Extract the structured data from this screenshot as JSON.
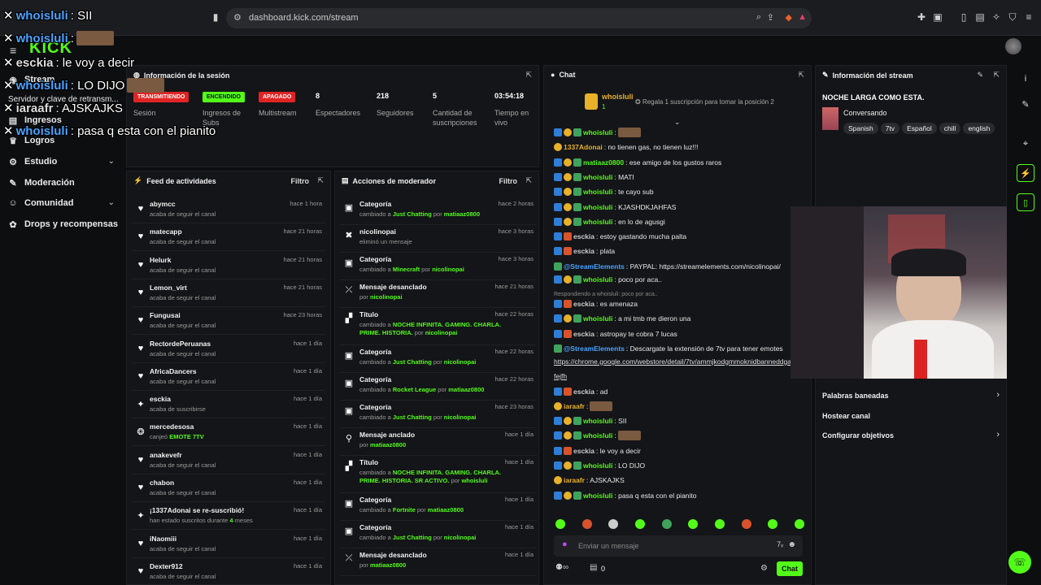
{
  "browser": {
    "url": "dashboard.kick.com/stream"
  },
  "app": {
    "logo": "KICK"
  },
  "sidebar": {
    "items": [
      {
        "label": "Stream",
        "icon": "stream-icon"
      },
      {
        "label": "Servidor y clave de retransm...",
        "icon": "key-icon"
      },
      {
        "label": "Ingresos",
        "icon": "money-icon"
      },
      {
        "label": "Logros",
        "icon": "trophy-icon"
      },
      {
        "label": "Estudio",
        "icon": "studio-icon",
        "expandable": true
      },
      {
        "label": "Moderación",
        "icon": "wrench-icon"
      },
      {
        "label": "Comunidad",
        "icon": "community-icon",
        "expandable": true
      },
      {
        "label": "Drops y recompensas",
        "icon": "gift-icon"
      }
    ]
  },
  "session": {
    "title": "Información de la sesión",
    "stats": [
      {
        "badge": "TRANSMITIENDO",
        "label": "Sesión",
        "color": "#e02424"
      },
      {
        "badge": "ENCENDIDO",
        "label": "Ingresos de Subs",
        "color": "#53fc18"
      },
      {
        "badge": "APAGADO",
        "label": "Multistream",
        "color": "#e02424"
      },
      {
        "value": "8",
        "label": "Espectadores"
      },
      {
        "value": "218",
        "label": "Seguidores"
      },
      {
        "value": "5",
        "label": "Cantidad de suscripciones"
      },
      {
        "value": "03:54:18",
        "label": "Tiempo en vivo"
      }
    ]
  },
  "feed": {
    "title": "Feed de actividades",
    "filter": "Filtro",
    "items": [
      {
        "name": "abymcc",
        "desc": "acaba de seguir el canal",
        "time": "hace 1 hora",
        "icon": "heart-icon"
      },
      {
        "name": "matecapp",
        "desc": "acaba de seguir el canal",
        "time": "hace 21 horas",
        "icon": "heart-icon"
      },
      {
        "name": "Helurk",
        "desc": "acaba de seguir el canal",
        "time": "hace 21 horas",
        "icon": "heart-icon"
      },
      {
        "name": "Lemon_virt",
        "desc": "acaba de seguir el canal",
        "time": "hace 21 horas",
        "icon": "heart-icon"
      },
      {
        "name": "Fungusai",
        "desc": "acaba de seguir el canal",
        "time": "hace 23 horas",
        "icon": "heart-icon"
      },
      {
        "name": "RectordePeruanas",
        "desc": "acaba de seguir el canal",
        "time": "hace 1 día",
        "icon": "heart-icon"
      },
      {
        "name": "AfricaDancers",
        "desc": "acaba de seguir el canal",
        "time": "hace 1 día",
        "icon": "heart-icon"
      },
      {
        "name": "esckia",
        "desc": "acaba de suscribirse",
        "time": "hace 1 día",
        "icon": "star-icon"
      },
      {
        "name": "mercedesosa",
        "desc_pre": "canjeó ",
        "desc_hl": "EMOTE 7TV",
        "time": "hace 1 día",
        "icon": "redeem-icon"
      },
      {
        "name": "anakevefr",
        "desc": "acaba de seguir el canal",
        "time": "hace 1 día",
        "icon": "heart-icon"
      },
      {
        "name": "chabon",
        "desc": "acaba de seguir el canal",
        "time": "hace 1 día",
        "icon": "heart-icon"
      },
      {
        "name": "¡1337Adonai se re-suscribió!",
        "desc_pre": "han estado suscritos durante ",
        "desc_hl": "4",
        "desc_post": " meses",
        "time": "hace 1 día",
        "icon": "star-icon"
      },
      {
        "name": "iNaomiii",
        "desc": "acaba de seguir el canal",
        "time": "hace 1 día",
        "icon": "heart-icon"
      },
      {
        "name": "Dexter912",
        "desc": "acaba de seguir el canal",
        "time": "hace 1 día",
        "icon": "heart-icon"
      }
    ]
  },
  "mod": {
    "title": "Acciones de moderador",
    "filter": "Filtro",
    "items": [
      {
        "name": "Categoría",
        "a": "cambiado a ",
        "b": "Just Chatting",
        "c": " por ",
        "d": "matiaaz0800",
        "time": "hace 2 horas",
        "icon": "category-icon"
      },
      {
        "name": "nicolinopai",
        "a": "eliminó un mensaje",
        "time": "hace 3 horas",
        "icon": "trash-icon"
      },
      {
        "name": "Categoría",
        "a": "cambiado a ",
        "b": "Minecraft",
        "c": " por ",
        "d": "nicolinopai",
        "time": "hace 3 horas",
        "icon": "category-icon"
      },
      {
        "name": "Mensaje desanclado",
        "a": "por ",
        "d": "nicolinopai",
        "time": "hace 21 horas",
        "icon": "unpin-icon"
      },
      {
        "name": "Título",
        "a": "cambiado a ",
        "b": "NOCHE INFINITA. GAMING. CHARLA. PRIME. HISTORIA.",
        "c": " por ",
        "d": "nicolinopai",
        "time": "hace 22 horas",
        "icon": "title-icon"
      },
      {
        "name": "Categoría",
        "a": "cambiado a ",
        "b": "Just Chatting",
        "c": " por ",
        "d": "nicolinopai",
        "time": "hace 22 horas",
        "icon": "category-icon"
      },
      {
        "name": "Categoría",
        "a": "cambiado a ",
        "b": "Rocket League",
        "c": " por ",
        "d": "matiaaz0800",
        "time": "hace 22 horas",
        "icon": "category-icon"
      },
      {
        "name": "Categoría",
        "a": "cambiado a ",
        "b": "Just Chatting",
        "c": " por ",
        "d": "nicolinopai",
        "time": "hace 23 horas",
        "icon": "category-icon"
      },
      {
        "name": "Mensaje anclado",
        "a": "por ",
        "d": "matiaaz0800",
        "time": "hace 1 día",
        "icon": "pin-icon"
      },
      {
        "name": "Título",
        "a": "cambiado a ",
        "b": "NOCHE INFINITA. GAMING. CHARLA. PRIME. HISTORIA. SR ACTIVO.",
        "c": " por ",
        "d": "whoisluli",
        "time": "hace 1 día",
        "icon": "title-icon"
      },
      {
        "name": "Categoría",
        "a": "cambiado a ",
        "b": "Fortnite",
        "c": " por ",
        "d": "matiaaz0800",
        "time": "hace 1 día",
        "icon": "category-icon"
      },
      {
        "name": "Categoría",
        "a": "cambiado a ",
        "b": "Just Chatting",
        "c": " por ",
        "d": "nicolinopai",
        "time": "hace 1 día",
        "icon": "category-icon"
      },
      {
        "name": "Mensaje desanclado",
        "a": "por ",
        "d": "matiaaz0800",
        "time": "hace 1 día",
        "icon": "unpin-icon"
      }
    ]
  },
  "chat": {
    "title": "Chat",
    "top_user": "whoisluli",
    "top_count": "1",
    "gift_text": "Regala 1 suscripción para tomar la posición 2",
    "reply_note": "Respondiendo a whoisluli: poco por aca..",
    "messages": [
      {
        "user": "whoisluli",
        "text": "",
        "color": "blue"
      },
      {
        "user": "1337Adonai",
        "text": "no tienen gas, no tienen luz!!!",
        "color": "gold"
      },
      {
        "user": "matiaaz0800",
        "text": "ese amigo de los gustos raros",
        "color": "blue"
      },
      {
        "user": "whoisluli",
        "text": "MATI",
        "color": "blue"
      },
      {
        "user": "whoisluli",
        "text": "te cayo sub",
        "color": "blue"
      },
      {
        "user": "whoisluli",
        "text": "KJASHDKJAHFAS",
        "color": "blue"
      },
      {
        "user": "whoisluli",
        "text": "en lo de agusgi",
        "color": "blue"
      },
      {
        "user": "esckia",
        "text": "estoy gastando mucha palta",
        "color": "grey"
      },
      {
        "user": "esckia",
        "text": "plata",
        "color": "grey"
      },
      {
        "user": "@StreamElements",
        "text": "PAYPAL: https://streamelements.com/nicolinopai/",
        "color": "green"
      },
      {
        "user": "whoisluli",
        "text": "poco por aca..",
        "color": "blue"
      },
      {
        "user": "esckia",
        "text": "es amenaza",
        "color": "grey"
      },
      {
        "user": "whoisluli",
        "text": "a mi tmb me dieron una",
        "color": "blue"
      },
      {
        "user": "esckia",
        "text": "astropay te cobra 7 lucas",
        "color": "grey"
      },
      {
        "user": "@StreamElements",
        "text": "Descargate la extensión de 7tv para tener emotes",
        "color": "green"
      },
      {
        "user": "",
        "text": "https://chrome.google.com/webstore/detail/7tv/ammjkodgmmoknidbanneddgar",
        "color": "link"
      },
      {
        "user": "",
        "text": "fejfh",
        "color": "link"
      },
      {
        "user": "esckia",
        "text": "ad",
        "color": "grey"
      },
      {
        "user": "iaraafr",
        "text": "",
        "color": "gold"
      },
      {
        "user": "whoisluli",
        "text": "SII",
        "color": "blue"
      },
      {
        "user": "whoisluli",
        "text": "",
        "color": "blue"
      },
      {
        "user": "esckia",
        "text": "le voy a decir",
        "color": "grey"
      },
      {
        "user": "whoisluli",
        "text": "LO DIJO",
        "color": "blue"
      },
      {
        "user": "iaraafr",
        "text": "AJSKAJKS",
        "color": "gold"
      },
      {
        "user": "whoisluli",
        "text": "pasa q esta con el pianito",
        "color": "blue"
      }
    ],
    "input_placeholder": "Enviar un mensaje",
    "viewer_count": "0",
    "send_label": "Chat"
  },
  "overlay": {
    "lines": [
      {
        "user": "whoisluli",
        "text": "SII"
      },
      {
        "user": "whoisluli",
        "text": ""
      },
      {
        "user": "esckia",
        "text": "le voy a decir"
      },
      {
        "user": "whoisluli",
        "text": "LO DIJO"
      },
      {
        "user": "iaraafr",
        "text": "AJSKAJKS"
      },
      {
        "user": "whoisluli",
        "text": "pasa q esta con el pianito"
      }
    ]
  },
  "stream_info": {
    "title": "Información del stream",
    "stream_title": "NOCHE LARGA COMO ESTA.",
    "category": "Conversando",
    "tags": [
      "Spanish",
      "7tv",
      "Español",
      "chill",
      "english"
    ],
    "links": [
      {
        "label": "Palabras baneadas",
        "arrow": true
      },
      {
        "label": "Hostear canal",
        "arrow": false
      },
      {
        "label": "Configurar objetivos",
        "arrow": true
      }
    ]
  }
}
